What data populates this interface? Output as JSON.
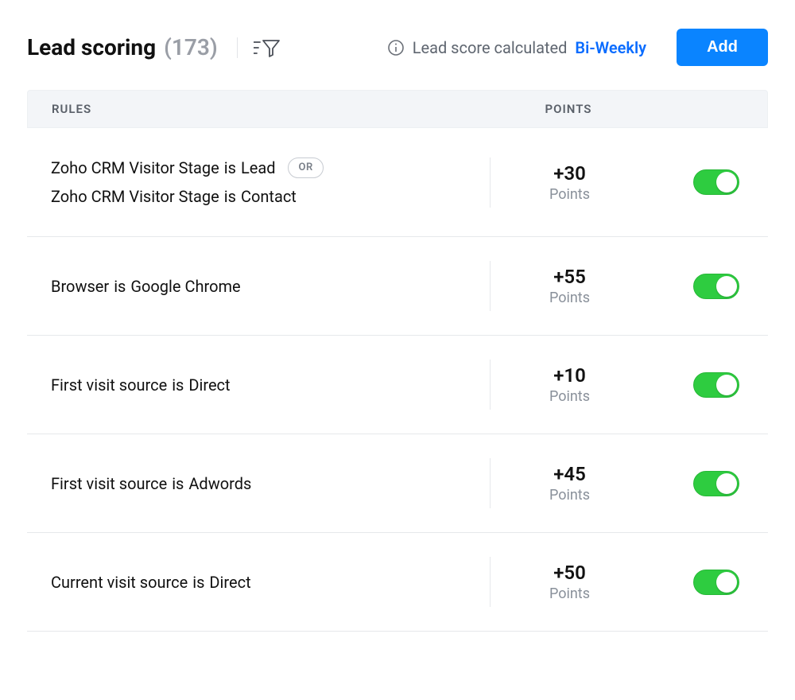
{
  "header": {
    "title": "Lead scoring",
    "count": "(173)",
    "calc_text": "Lead score calculated",
    "calc_interval": "Bi-Weekly",
    "add_label": "Add"
  },
  "columns": {
    "rules": "RULES",
    "points": "POINTS"
  },
  "rows": [
    {
      "conditions": [
        {
          "field": "Zoho CRM Visitor Stage",
          "operator": "is",
          "value": "Lead",
          "connector": "OR"
        },
        {
          "field": "Zoho CRM Visitor Stage",
          "operator": "is",
          "value": "Contact"
        }
      ],
      "points": "+30",
      "points_label": "Points",
      "enabled": true
    },
    {
      "conditions": [
        {
          "field": "Browser",
          "operator": "is",
          "value": "Google Chrome"
        }
      ],
      "points": "+55",
      "points_label": "Points",
      "enabled": true
    },
    {
      "conditions": [
        {
          "field": "First visit source",
          "operator": "is",
          "value": "Direct"
        }
      ],
      "points": "+10",
      "points_label": "Points",
      "enabled": true
    },
    {
      "conditions": [
        {
          "field": "First visit source",
          "operator": "is",
          "value": "Adwords"
        }
      ],
      "points": "+45",
      "points_label": "Points",
      "enabled": true
    },
    {
      "conditions": [
        {
          "field": "Current visit source",
          "operator": "is",
          "value": "Direct"
        }
      ],
      "points": "+50",
      "points_label": "Points",
      "enabled": true
    }
  ]
}
